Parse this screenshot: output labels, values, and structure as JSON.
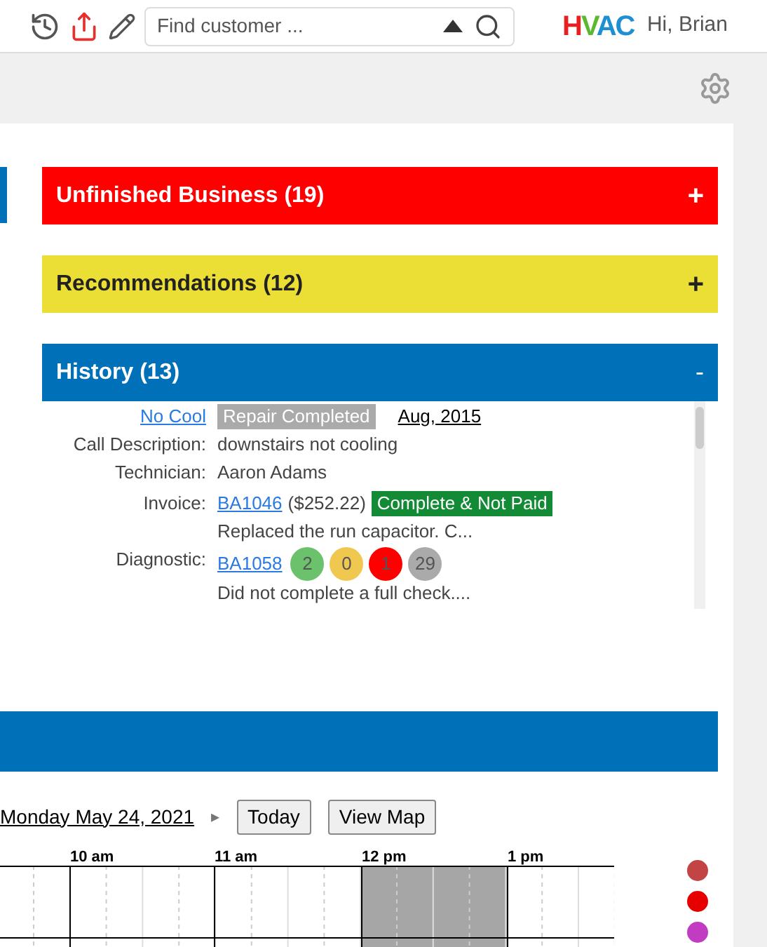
{
  "header": {
    "search": {
      "placeholder": "Find customer ..."
    },
    "logo": [
      {
        "text": "H",
        "color": "#e42020"
      },
      {
        "text": "V",
        "color": "#5cb82e"
      },
      {
        "text": "AC",
        "color": "#1e8fd2"
      }
    ],
    "greeting": "Hi, Brian"
  },
  "sections": [
    {
      "title": "Unfinished Business (19)",
      "toggle": "+",
      "color": "#ff0000",
      "expanded": false
    },
    {
      "title": "Recommendations (12)",
      "toggle": "+",
      "color": "#ebdf35",
      "expanded": false
    },
    {
      "title": "History (13)",
      "toggle": "-",
      "color": "#0070b8",
      "expanded": true
    }
  ],
  "history": {
    "call_type": "No Cool",
    "status": "Repair Completed",
    "date": "Aug, 2015",
    "call_description_label": "Call Description:",
    "call_description": "downstairs not cooling",
    "technician_label": "Technician:",
    "technician": "Aaron Adams",
    "invoice_label": "Invoice:",
    "invoice": "BA1046",
    "invoice_amount": "($252.22)",
    "invoice_status": "Complete & Not Paid",
    "invoice_note": "Replaced the run capacitor. C...",
    "diagnostic_label": "Diagnostic:",
    "diagnostic": "BA1058",
    "diagnostic_counts": [
      {
        "value": "2",
        "color": "#6cc16c"
      },
      {
        "value": "0",
        "color": "#f0c850"
      },
      {
        "value": "1",
        "color": "#ff0000"
      },
      {
        "value": "29",
        "color": "#aaaaaa"
      }
    ],
    "diagnostic_note": "Did not complete a full check...."
  },
  "schedule": {
    "date": "Monday May 24, 2021",
    "next": "▸",
    "buttons": [
      "Today",
      "View Map"
    ],
    "hours": [
      "10 am",
      "11 am",
      "12 pm",
      "1 pm"
    ],
    "techs": [
      {
        "color": "#c24444"
      },
      {
        "color": "#e60000"
      },
      {
        "color": "#c23cc2"
      }
    ]
  }
}
